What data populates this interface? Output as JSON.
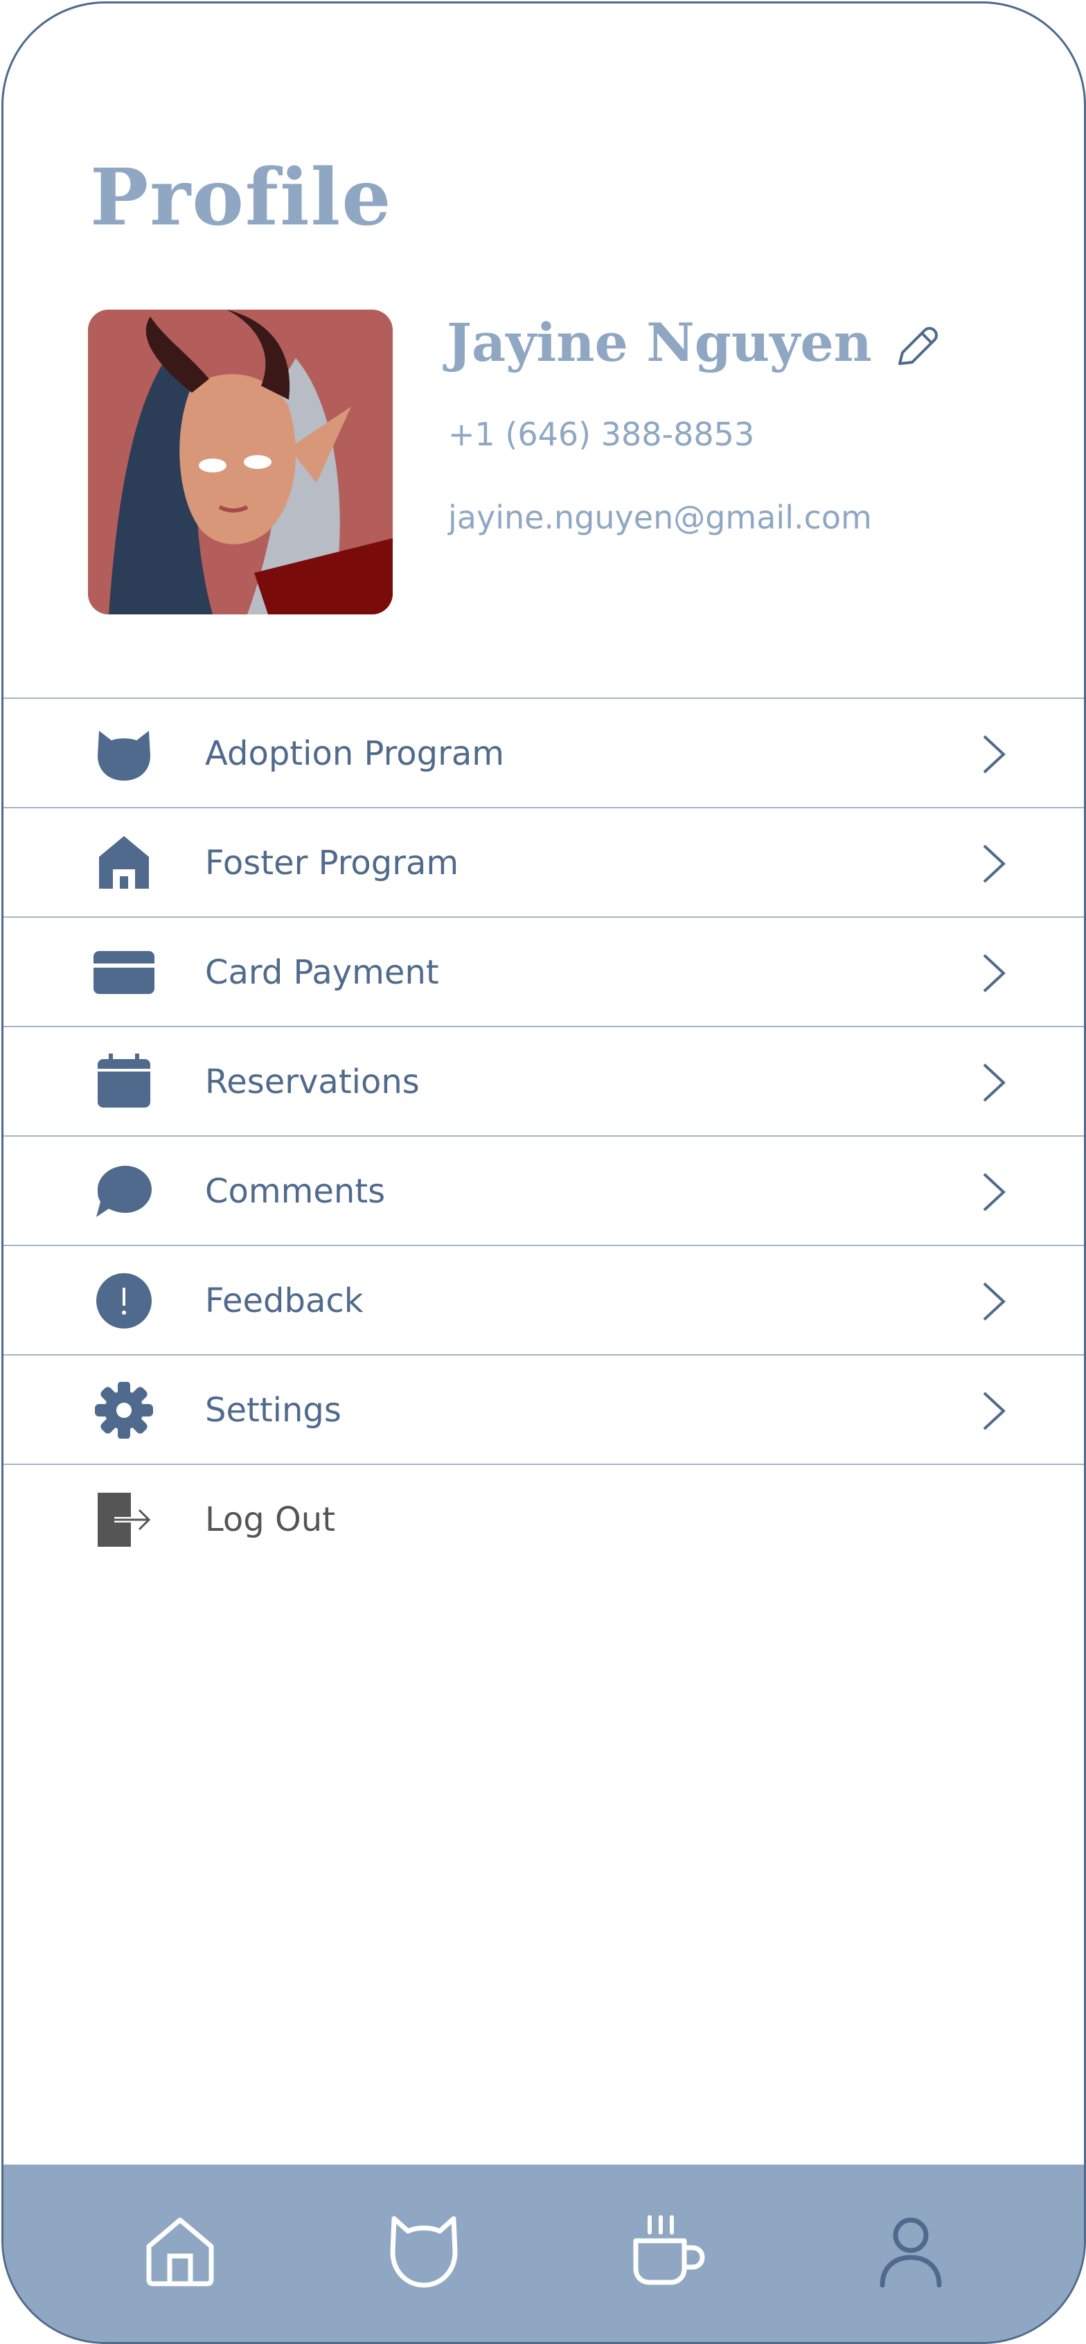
{
  "page": {
    "title": "Profile"
  },
  "user": {
    "name": "Jayine Nguyen",
    "phone": "+1 (646) 388-8853",
    "email": "jayine.nguyen@gmail.com",
    "avatar_icon": "profile-picture"
  },
  "menu": {
    "items": [
      {
        "label": "Adoption Program",
        "icon": "cat-head-icon"
      },
      {
        "label": "Foster Program",
        "icon": "home-icon"
      },
      {
        "label": "Card Payment",
        "icon": "credit-card-icon"
      },
      {
        "label": "Reservations",
        "icon": "calendar-icon"
      },
      {
        "label": "Comments",
        "icon": "chat-bubble-icon"
      },
      {
        "label": "Feedback",
        "icon": "alert-circle-icon"
      },
      {
        "label": "Settings",
        "icon": "gear-icon"
      },
      {
        "label": "Log Out",
        "icon": "logout-icon"
      }
    ]
  },
  "bottom_nav": {
    "items": [
      {
        "icon": "home-icon"
      },
      {
        "icon": "cat-icon"
      },
      {
        "icon": "coffee-cup-icon"
      },
      {
        "icon": "user-icon"
      }
    ]
  },
  "colors": {
    "accent": "#8fa7c3",
    "icon": "#4f6a8c",
    "divider": "#a3b4c8",
    "logout": "#555555"
  }
}
